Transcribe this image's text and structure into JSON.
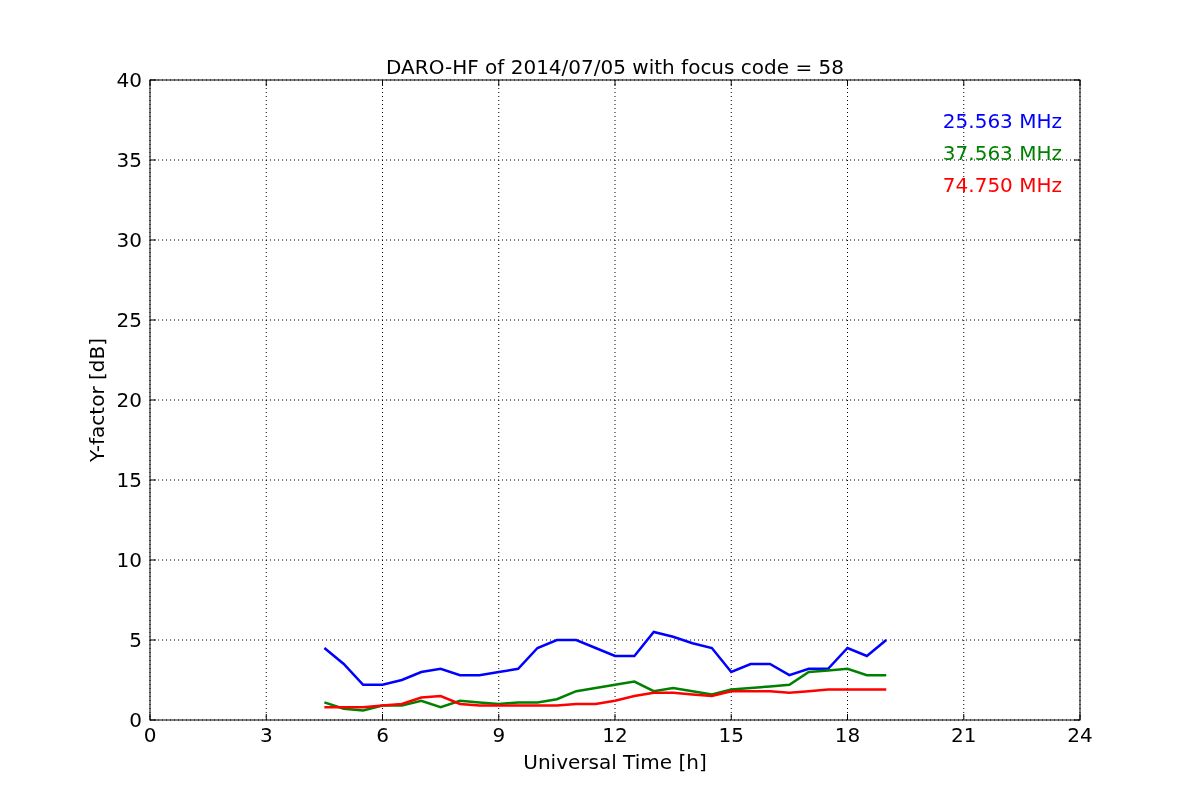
{
  "chart_data": {
    "type": "line",
    "title": "DARO-HF of 2014/07/05 with focus code = 58",
    "xlabel": "Universal Time [h]",
    "ylabel": "Y-factor [dB]",
    "x": [
      4.5,
      5,
      5.5,
      6,
      6.5,
      7,
      7.5,
      8,
      8.5,
      9,
      9.5,
      10,
      10.5,
      11,
      11.5,
      12,
      12.5,
      13,
      13.5,
      14,
      14.5,
      15,
      15.5,
      16,
      16.5,
      17,
      17.5,
      18,
      18.5,
      19
    ],
    "series": [
      {
        "name": "25.563 MHz",
        "color": "#0000ff",
        "values": [
          4.5,
          3.5,
          2.2,
          2.2,
          2.5,
          3,
          3.2,
          2.8,
          2.8,
          3,
          3.2,
          4.5,
          5,
          5,
          4.5,
          4,
          4,
          5.5,
          5.2,
          4.8,
          4.5,
          3,
          3.5,
          3.5,
          2.8,
          3.2,
          3.2,
          4.5,
          4,
          5
        ]
      },
      {
        "name": "37.563 MHz",
        "color": "#008000",
        "values": [
          1.1,
          0.7,
          0.6,
          0.9,
          0.9,
          1.2,
          0.8,
          1.2,
          1.1,
          1,
          1.1,
          1.1,
          1.3,
          1.8,
          2,
          2.2,
          2.4,
          1.8,
          2,
          1.8,
          1.6,
          1.9,
          2,
          2.1,
          2.2,
          3,
          3.1,
          3.2,
          2.8,
          2.8
        ]
      },
      {
        "name": "74.750 MHz",
        "color": "#ff0000",
        "values": [
          0.8,
          0.8,
          0.8,
          0.9,
          1,
          1.4,
          1.5,
          1,
          0.9,
          0.9,
          0.9,
          0.9,
          0.9,
          1,
          1,
          1.2,
          1.5,
          1.7,
          1.7,
          1.6,
          1.5,
          1.8,
          1.8,
          1.8,
          1.7,
          1.8,
          1.9,
          1.9,
          1.9,
          1.9
        ]
      }
    ],
    "grid": true,
    "xlim": [
      0,
      24
    ],
    "ylim": [
      0,
      40
    ],
    "xticks": [
      0,
      3,
      6,
      9,
      12,
      15,
      18,
      21,
      24
    ],
    "yticks": [
      0,
      5,
      10,
      15,
      20,
      25,
      30,
      35,
      40
    ]
  }
}
